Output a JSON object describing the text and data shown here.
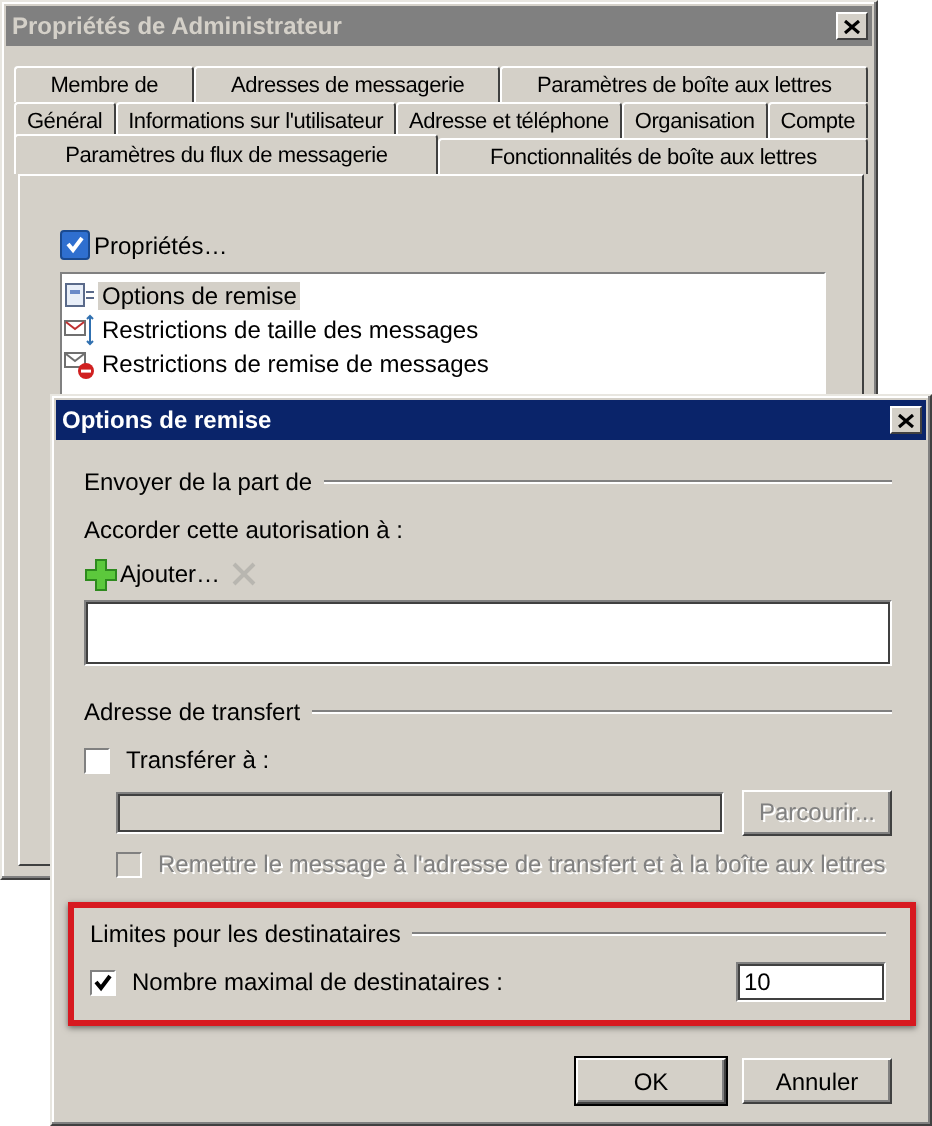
{
  "back_window": {
    "title": "Propriétés de Administrateur",
    "active": false,
    "tab_rows": [
      {
        "tabs": [
          {
            "label": "Membre de",
            "selected": false
          },
          {
            "label": "Adresses de messagerie",
            "selected": false
          },
          {
            "label": "Paramètres de boîte aux lettres",
            "selected": false
          }
        ]
      },
      {
        "tabs": [
          {
            "label": "Général",
            "selected": false
          },
          {
            "label": "Informations sur l'utilisateur",
            "selected": false
          },
          {
            "label": "Adresse et téléphone",
            "selected": false
          },
          {
            "label": "Organisation",
            "selected": false
          },
          {
            "label": "Compte",
            "selected": false
          }
        ]
      },
      {
        "tabs": [
          {
            "label": "Paramètres du flux de messagerie",
            "selected": true
          },
          {
            "label": "Fonctionnalités de boîte aux lettres",
            "selected": false
          }
        ]
      }
    ],
    "properties_toggle": {
      "label": "Propriétés…",
      "checked": true
    },
    "features": [
      {
        "label": "Options de remise",
        "kind": "options",
        "selected": true
      },
      {
        "label": "Restrictions de taille des messages",
        "kind": "size",
        "selected": false
      },
      {
        "label": "Restrictions de remise de messages",
        "kind": "restrict",
        "selected": false
      }
    ]
  },
  "dialog": {
    "title": "Options de remise",
    "active": true,
    "sender": {
      "heading": "Envoyer de la part de",
      "permission_label": "Accorder cette autorisation à :",
      "add_button": "Ajouter…",
      "remove_disabled": true
    },
    "forwarding": {
      "heading": "Adresse de transfert",
      "forward_to": {
        "label": "Transférer à :",
        "checked": false,
        "disabled": false
      },
      "address_disabled": true,
      "browse_button": {
        "label": "Parcourir...",
        "disabled": true
      },
      "deliver_both": {
        "label": "Remettre le message à l'adresse de transfert et à la boîte aux lettres",
        "checked": false,
        "disabled": true
      }
    },
    "limits": {
      "heading": "Limites pour les destinataires",
      "highlighted": true,
      "max_recipients": {
        "label": "Nombre maximal de destinataires :",
        "checked": true,
        "disabled": false,
        "value": "10"
      }
    },
    "buttons": [
      {
        "label": "OK",
        "default": true
      },
      {
        "label": "Annuler",
        "default": false
      }
    ]
  }
}
